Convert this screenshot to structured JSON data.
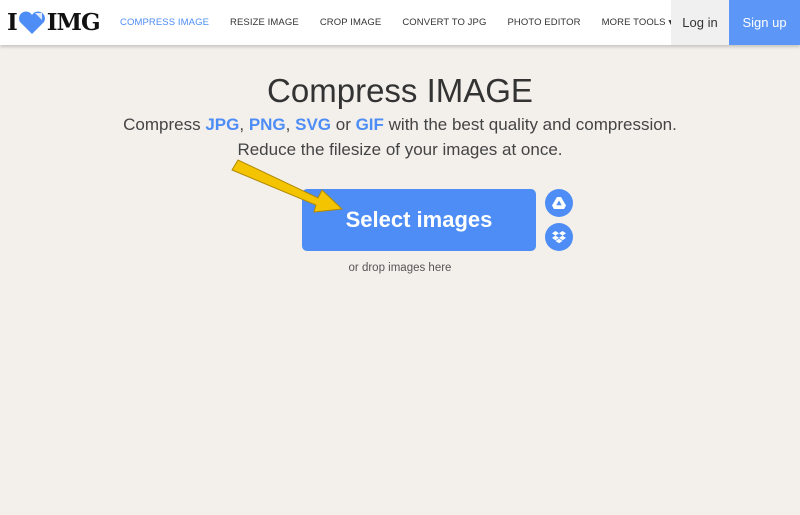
{
  "nav": {
    "logo": "I ♥ IMG",
    "logo_left": "I",
    "logo_right": "IMG",
    "items": [
      {
        "label": "COMPRESS IMAGE",
        "active": true
      },
      {
        "label": "RESIZE IMAGE"
      },
      {
        "label": "CROP IMAGE"
      },
      {
        "label": "CONVERT TO JPG"
      },
      {
        "label": "PHOTO EDITOR"
      },
      {
        "label": "MORE TOOLS ▾"
      }
    ],
    "login": "Log in",
    "signup": "Sign up"
  },
  "main": {
    "title": "Compress IMAGE",
    "line1": {
      "pre": "Compress ",
      "f1": "JPG",
      "s1": ", ",
      "f2": "PNG",
      "s2": ", ",
      "f3": "SVG",
      "s3": " or ",
      "f4": "GIF",
      "post": " with the best quality and compression."
    },
    "line2": "Reduce the filesize of your images at once.",
    "select_label": "Select images",
    "drop_text": "or drop images here"
  },
  "colors": {
    "accent": "#4d8df5",
    "arrow": "#f5c400",
    "background": "#f3f0ec"
  },
  "icons": [
    "google-drive-icon",
    "dropbox-icon",
    "heart-icon",
    "arrow-annotation"
  ]
}
